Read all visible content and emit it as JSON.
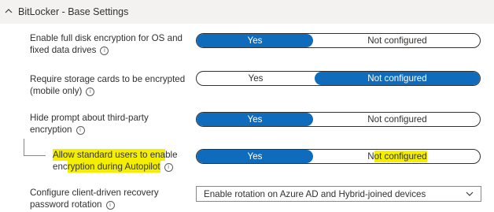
{
  "section": {
    "title": "BitLocker - Base Settings",
    "icon": "chevron-up-icon"
  },
  "settings": [
    {
      "label_line1": "Enable full disk encryption for OS and",
      "label_line2": "fixed data drives",
      "options": [
        "Yes",
        "Not configured"
      ],
      "selected": "Yes"
    },
    {
      "label_line1": "Require storage cards to be encrypted",
      "label_line2": "(mobile only)",
      "options": [
        "Yes",
        "Not configured"
      ],
      "selected": "Not configured"
    },
    {
      "label_line1": "Hide prompt about third-party",
      "label_line2": "encryption",
      "options": [
        "Yes",
        "Not configured"
      ],
      "selected": "Yes"
    },
    {
      "label_line1_a": "Allow standard users to ena",
      "label_line1_b": "ble",
      "label_line2_a": "enc",
      "label_line2_b": "ryption during Autopilot",
      "options": [
        "Yes"
      ],
      "right_option_a": "N",
      "right_option_b": "ot configured",
      "selected": "Yes",
      "nested": true,
      "highlight_color": "#f4ef00"
    }
  ],
  "rotation": {
    "label_line1": "Configure client-driven recovery",
    "label_line2": "password rotation",
    "value": "Enable rotation on Azure AD and Hybrid-joined devices",
    "icon": "chevron-down-icon"
  },
  "info_glyph": "i",
  "colors": {
    "accent": "#0f6cbd",
    "header_bg": "#f3f2f1",
    "highlight": "#f4ef00"
  }
}
